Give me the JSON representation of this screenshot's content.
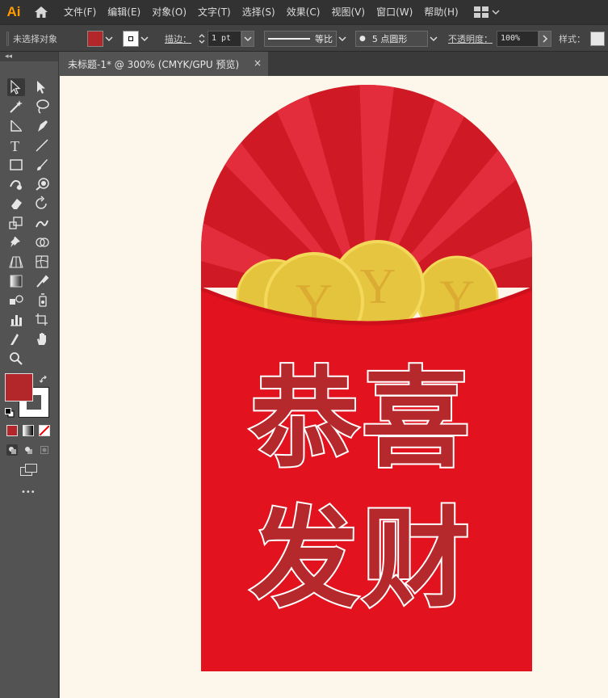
{
  "app": {
    "logo": "Ai"
  },
  "menu": [
    "文件(F)",
    "编辑(E)",
    "对象(O)",
    "文字(T)",
    "选择(S)",
    "效果(C)",
    "视图(V)",
    "窗口(W)",
    "帮助(H)"
  ],
  "control": {
    "selection_status": "未选择对象",
    "fill_color": "#b3262a",
    "stroke_label": "描边：",
    "stroke_weight": "1 pt",
    "stroke_profile": "等比",
    "brush": "5 点圆形",
    "opacity_label": "不透明度：",
    "opacity_value": "100%",
    "style_label": "样式："
  },
  "document_tab": {
    "title": "未标题-1* @ 300% (CMYK/GPU 预览)",
    "close": "×"
  },
  "toolbar": {
    "collapse": "◂◂",
    "fill_color": "#b3262a",
    "stroke_color": "#ffffff",
    "more": "•••",
    "tools": [
      "selection-tool",
      "direct-selection-tool",
      "magic-wand-tool",
      "lasso-tool",
      "line-tool",
      "pen-tool",
      "type-tool",
      "line-segment-tool",
      "rectangle-tool",
      "paintbrush-tool",
      "shaper-tool",
      "blob-brush-tool",
      "eraser-tool",
      "rotate-tool",
      "scale-tool",
      "warp-tool",
      "pin-tool",
      "shape-builder-tool",
      "perspective-grid-tool",
      "mesh-tool",
      "gradient-tool",
      "eyedropper-tool",
      "blend-tool",
      "symbol-sprayer-tool",
      "column-graph-tool",
      "artboard-tool",
      "slice-tool",
      "hand-tool",
      "zoom-tool"
    ]
  },
  "artwork": {
    "line1": "恭喜",
    "line2": "发财",
    "coin_symbol": "Y",
    "envelope_color": "#e3121f",
    "text_color": "#b5292c",
    "coin_color": "#e6c53e"
  }
}
